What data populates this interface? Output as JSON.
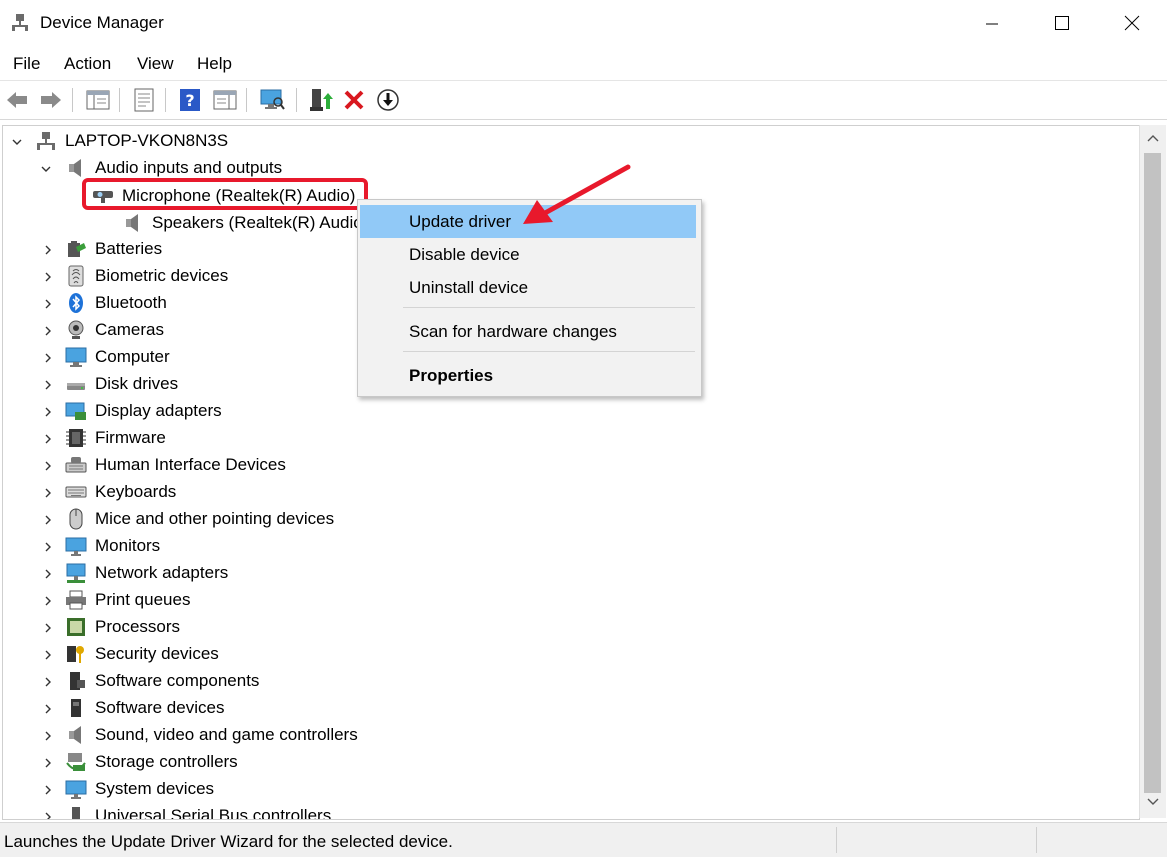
{
  "window": {
    "title": "Device Manager"
  },
  "menu": [
    "File",
    "Action",
    "View",
    "Help"
  ],
  "toolbar": [
    "back-icon",
    "forward-icon",
    "show-hide-console-tree-icon",
    "properties-icon",
    "help-icon",
    "action-pane-icon",
    "scan-hardware-icon",
    "update-driver-icon",
    "uninstall-icon",
    "disable-icon"
  ],
  "tree": {
    "root": "LAPTOP-VKON8N3S",
    "audio": {
      "label": "Audio inputs and outputs",
      "children": [
        "Microphone (Realtek(R) Audio)",
        "Speakers (Realtek(R) Audio)"
      ]
    },
    "categories": [
      "Batteries",
      "Biometric devices",
      "Bluetooth",
      "Cameras",
      "Computer",
      "Disk drives",
      "Display adapters",
      "Firmware",
      "Human Interface Devices",
      "Keyboards",
      "Mice and other pointing devices",
      "Monitors",
      "Network adapters",
      "Print queues",
      "Processors",
      "Security devices",
      "Software components",
      "Software devices",
      "Sound, video and game controllers",
      "Storage controllers",
      "System devices",
      "Universal Serial Bus controllers"
    ]
  },
  "context_menu": {
    "update": "Update driver",
    "disable": "Disable device",
    "uninstall": "Uninstall device",
    "scan": "Scan for hardware changes",
    "properties": "Properties"
  },
  "status": "Launches the Update Driver Wizard for the selected device.",
  "colors": {
    "highlight_box": "#e8192c",
    "menu_hover": "#91c9f7",
    "arrow": "#e8192c"
  }
}
